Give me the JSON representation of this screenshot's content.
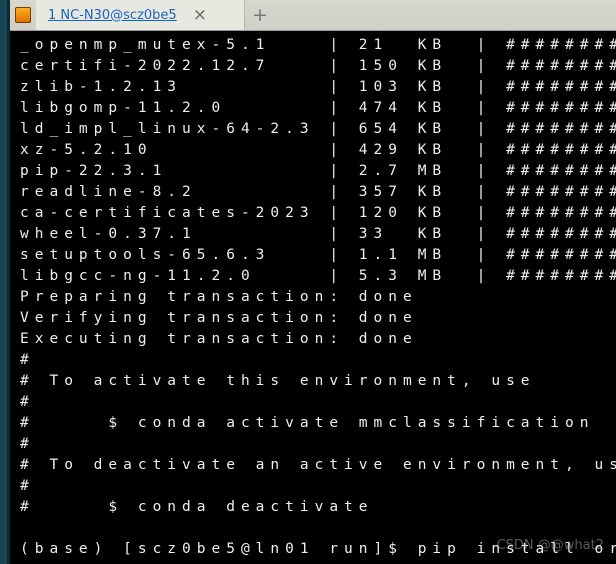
{
  "tab": {
    "title": "1 NC-N30@scz0be5"
  },
  "packages": [
    {
      "name": "_openmp_mutex-5.1",
      "size": "21 KB",
      "size_pad": "21  KB "
    },
    {
      "name": "certifi-2022.12.7",
      "size": "150 KB",
      "size_pad": "150 KB "
    },
    {
      "name": "zlib-1.2.13",
      "size": "103 KB",
      "size_pad": "103 KB "
    },
    {
      "name": "libgomp-11.2.0",
      "size": "474 KB",
      "size_pad": "474 KB "
    },
    {
      "name": "ld_impl_linux-64-2.3",
      "size": "654 KB",
      "size_pad": "654 KB "
    },
    {
      "name": "xz-5.2.10",
      "size": "429 KB",
      "size_pad": "429 KB "
    },
    {
      "name": "pip-22.3.1",
      "size": "2.7 MB",
      "size_pad": "2.7 MB "
    },
    {
      "name": "readline-8.2",
      "size": "357 KB",
      "size_pad": "357 KB "
    },
    {
      "name": "ca-certificates-2023",
      "size": "120 KB",
      "size_pad": "120 KB "
    },
    {
      "name": "wheel-0.37.1",
      "size": "33 KB",
      "size_pad": "33  KB "
    },
    {
      "name": "setuptools-65.6.3",
      "size": "1.1 MB",
      "size_pad": "1.1 MB "
    },
    {
      "name": "libgcc-ng-11.2.0",
      "size": "5.3 MB",
      "size_pad": "5.3 MB "
    }
  ],
  "bar": "##########",
  "column_widths": {
    "name": 20,
    "size": 7
  },
  "status_lines": [
    "Preparing transaction: done",
    "Verifying transaction: done",
    "Executing transaction: done"
  ],
  "help_lines": [
    "#",
    "# To activate this environment, use",
    "#",
    "#     $ conda activate mmclassification",
    "#",
    "# To deactivate an active environment, use",
    "#",
    "#     $ conda deactivate",
    ""
  ],
  "prompt": "(base) [scz0be5@ln01 run]$ ",
  "typed": "pip install or_h=",
  "watermark": "CSDN @@what2"
}
